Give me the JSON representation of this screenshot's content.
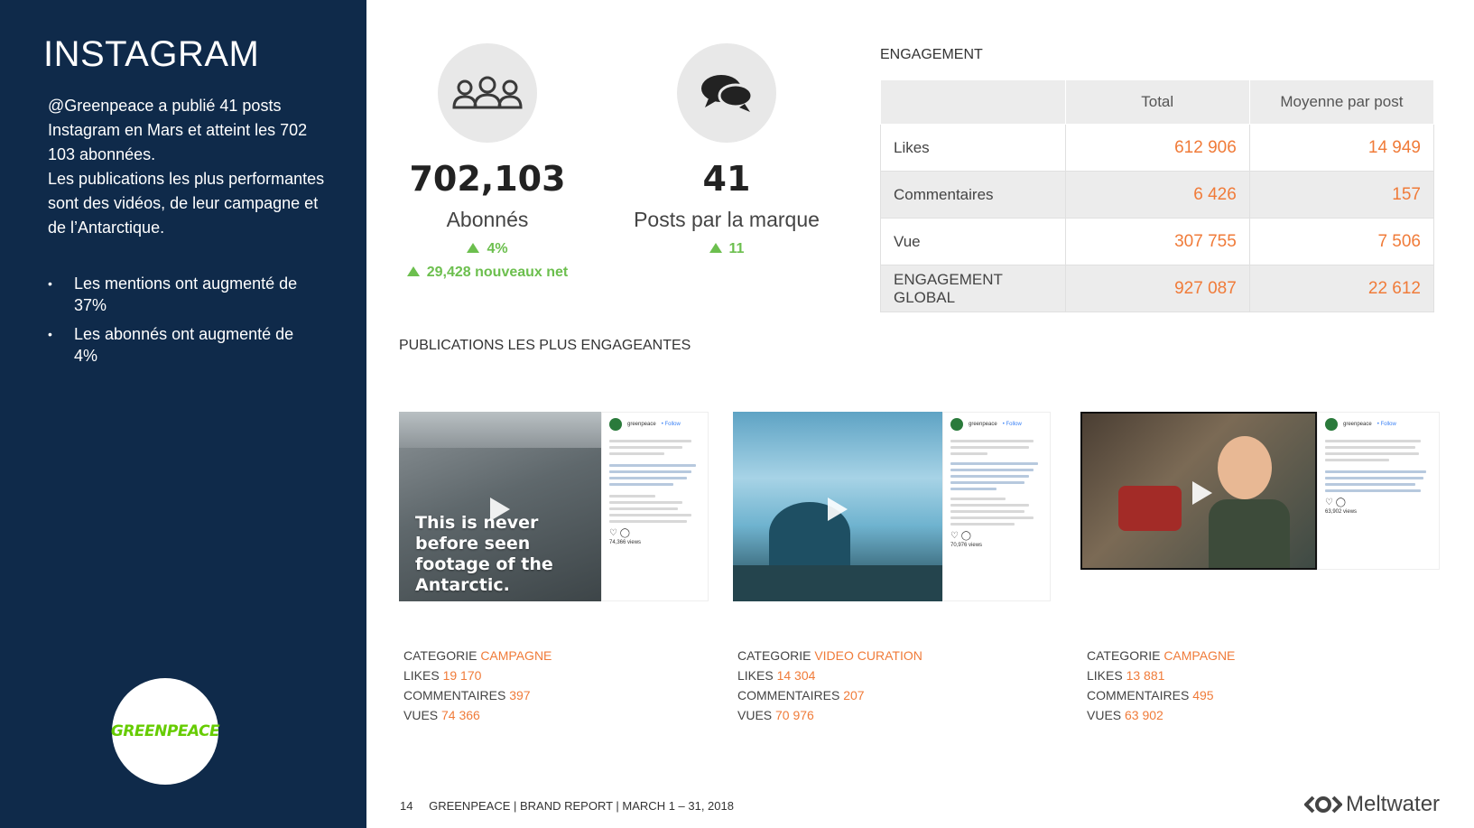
{
  "sidebar": {
    "title": "INSTAGRAM",
    "paragraph1": "@Greenpeace a publié 41 posts Instagram en Mars et atteint les 702 103 abonnées.",
    "paragraph2": "Les publications les plus performantes sont des vidéos, de leur campagne et de l’Antarctique.",
    "bullets": [
      "Les mentions ont augmenté de 37%",
      "Les abonnés ont augmenté de 4%"
    ],
    "logo_text": "GREENPEACE",
    "bullet_char": "•"
  },
  "stats": {
    "followers": {
      "value": "702,103",
      "label": "Abonnés",
      "delta_pct": "4%",
      "delta_new": "29,428 nouveaux net",
      "icon": "users-icon"
    },
    "posts": {
      "value": "41",
      "label": "Posts par la marque",
      "delta": "11",
      "icon": "chat-bubbles-icon"
    }
  },
  "engagement": {
    "title": "ENGAGEMENT",
    "headers": [
      "",
      "Total",
      "Moyenne par post"
    ],
    "rows": [
      {
        "label": "Likes",
        "total": "612 906",
        "avg": "14 949"
      },
      {
        "label": "Commentaires",
        "total": "6 426",
        "avg": "157"
      },
      {
        "label": "Vue",
        "total": "307 755",
        "avg": "7 506"
      },
      {
        "label": "ENGAGEMENT GLOBAL",
        "total": "927 087",
        "avg": "22 612"
      }
    ]
  },
  "publications": {
    "title": "PUBLICATIONS LES PLUS ENGAGEANTES",
    "posts": [
      {
        "caption": "This is never before seen footage of the Antarctic.",
        "account": "greenpeace",
        "follow": "• Follow",
        "views": "74,366 views",
        "categorie_label": "CATEGORIE",
        "categorie": "CAMPAGNE",
        "likes_label": "LIKES",
        "likes": "19 170",
        "comments_label": "COMMENTAIRES",
        "comments": "397",
        "views_label": "VUES",
        "views_value": "74 366"
      },
      {
        "caption": "",
        "account": "greenpeace",
        "follow": "• Follow",
        "views": "70,976 views",
        "categorie_label": "CATEGORIE",
        "categorie": "VIDEO CURATION",
        "likes_label": "LIKES",
        "likes": "14 304",
        "comments_label": "COMMENTAIRES",
        "comments": "207",
        "views_label": "VUES",
        "views_value": "70 976"
      },
      {
        "caption": "",
        "account": "greenpeace",
        "follow": "• Follow",
        "views": "63,902 views",
        "categorie_label": "CATEGORIE",
        "categorie": "CAMPAGNE",
        "likes_label": "LIKES",
        "likes": "13 881",
        "comments_label": "COMMENTAIRES",
        "comments": "495",
        "views_label": "VUES",
        "views_value": "63 902"
      }
    ]
  },
  "footer": {
    "page": "14",
    "text": "GREENPEACE | BRAND REPORT | MARCH 1 – 31,  2018",
    "brand": "Meltwater"
  },
  "colors": {
    "sidebar_bg": "#0f2a4a",
    "accent_orange": "#f07b39",
    "accent_green": "#6cbf4e"
  }
}
